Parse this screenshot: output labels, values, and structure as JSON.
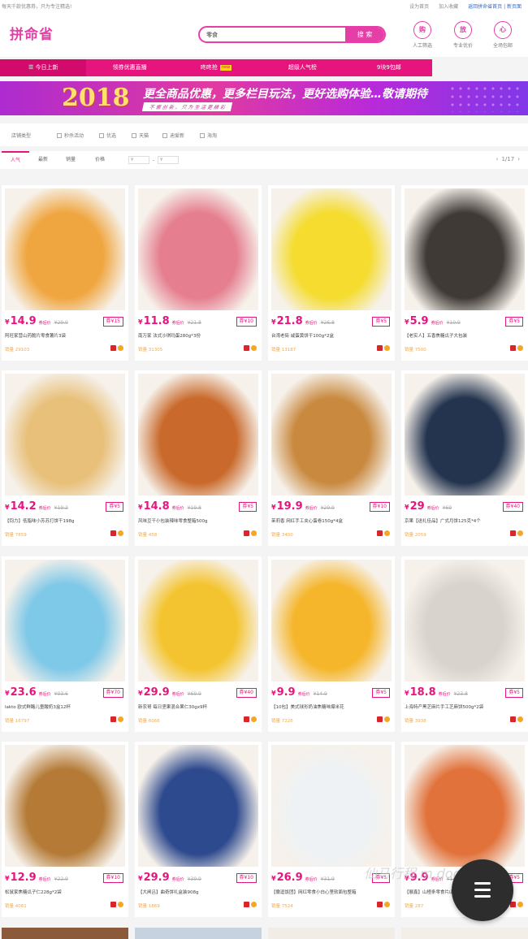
{
  "topbar": {
    "left_text": "每天千款优惠券，只为专注精选!",
    "links": [
      "设为首页",
      "加入收藏",
      "返回拼命省首页 | 新页面"
    ]
  },
  "header": {
    "logo": "拼命省",
    "search_value": "零食",
    "search_button": "搜 索",
    "services": [
      {
        "glyph": "购",
        "label": "人工筛选"
      },
      {
        "glyph": "放",
        "label": "专业优价"
      },
      {
        "glyph": "心",
        "label": "全场包邮"
      }
    ]
  },
  "nav": {
    "items": [
      "☰ 今日上新",
      "领券优惠直播",
      "咚咚抢",
      "超级人气榜",
      "9块9包邮"
    ],
    "new_badge": "new"
  },
  "banner": {
    "year": "2018",
    "slogan": "更全商品优惠，更多栏目玩法，更好选购体验…敬请期待",
    "sub": "不 懈 创 新 ， 只 为 生 活 更 精 彩"
  },
  "filter": {
    "label": "店铺类型",
    "options": [
      "秒杀活动",
      "优选",
      "天猫",
      "迪爱新",
      "海淘"
    ]
  },
  "sort": {
    "tabs": [
      "人气",
      "最新",
      "销量",
      "价格"
    ],
    "price_from": "¥",
    "price_to": "¥",
    "pager": "1/17"
  },
  "product_labels": {
    "coupon_price": "券后价",
    "sales_label": "销量"
  },
  "products": [
    {
      "price": "14.9",
      "old": "29.9",
      "coupon": "券¥15",
      "name": "阿旺家营山药脆片零食薯片3袋",
      "sales": "29103",
      "hue": "#f0a640"
    },
    {
      "price": "11.8",
      "old": "21.8",
      "coupon": "券¥10",
      "name": "南万家 法式沙琪玛蛋280g*3份",
      "sales": "31305",
      "hue": "#e57e8f"
    },
    {
      "price": "21.8",
      "old": "26.8",
      "coupon": "券¥5",
      "name": "台湾老街 咸蛋黄饼干100g*2盒",
      "sales": "13187",
      "hue": "#f5dc2e"
    },
    {
      "price": "5.9",
      "old": "10.9",
      "coupon": "券¥5",
      "name": "【老实人】五香焦糖瓜子大包装",
      "sales": "7500",
      "hue": "#3f3a35"
    },
    {
      "price": "14.2",
      "old": "19.2",
      "coupon": "券¥5",
      "name": "【钧力】低脂味小苏苏打饼干198g",
      "sales": "7859",
      "hue": "#e8c07a"
    },
    {
      "price": "14.8",
      "old": "19.8",
      "coupon": "券¥5",
      "name": "风味豆干小包装辣味零食整箱500g",
      "sales": "458",
      "hue": "#c96a2c"
    },
    {
      "price": "19.9",
      "old": "29.9",
      "coupon": "券¥10",
      "name": "茉莉香 网红手工夹心蛋卷150g*4盒",
      "sales": "3400",
      "hue": "#c98a40"
    },
    {
      "price": "29",
      "old": "69",
      "coupon": "券¥40",
      "name": "京果【送礼佳品】广式月饼125克*4个",
      "sales": "2059",
      "hue": "#24344f"
    },
    {
      "price": "23.6",
      "old": "93.6",
      "coupon": "券¥70",
      "name": "lakto 欧式鲜酪儿童酸奶3盒12杯",
      "sales": "16797",
      "hue": "#7ec8e8"
    },
    {
      "price": "29.9",
      "old": "69.9",
      "coupon": "券¥40",
      "name": "新农哥 每日坚果混合果仁30gx9杯",
      "sales": "6066",
      "hue": "#f4c430"
    },
    {
      "price": "9.9",
      "old": "14.9",
      "coupon": "券¥5",
      "name": "【10包】美式球形奶油焦糖味爆米花",
      "sales": "7226",
      "hue": "#f5b62c"
    },
    {
      "price": "18.8",
      "old": "23.8",
      "coupon": "券¥5",
      "name": "上海特产黑芝麻片手工芝麻饼500g*2袋",
      "sales": "3938",
      "hue": "#d8d3cc"
    },
    {
      "price": "12.9",
      "old": "22.9",
      "coupon": "券¥10",
      "name": "松鼠家焦糖瓜子仁228g*2袋",
      "sales": "4061",
      "hue": "#b47a36"
    },
    {
      "price": "29.9",
      "old": "39.9",
      "coupon": "券¥10",
      "name": "【大闸吕】曲奇饼礼盒装908g",
      "sales": "1869",
      "hue": "#2e4a8e"
    },
    {
      "price": "26.9",
      "old": "31.9",
      "coupon": "券¥5",
      "name": "【撒逗饭团】网红零食小白心里软面包整箱",
      "sales": "7524",
      "hue": "#eef2f5"
    },
    {
      "price": "9.9",
      "old": "14.9",
      "coupon": "券¥5",
      "name": "【展鑫】山楂条零食片山楂干大包装",
      "sales": "287",
      "hue": "#e2723b"
    }
  ],
  "watermark": "仙马行程 m.dog.org"
}
